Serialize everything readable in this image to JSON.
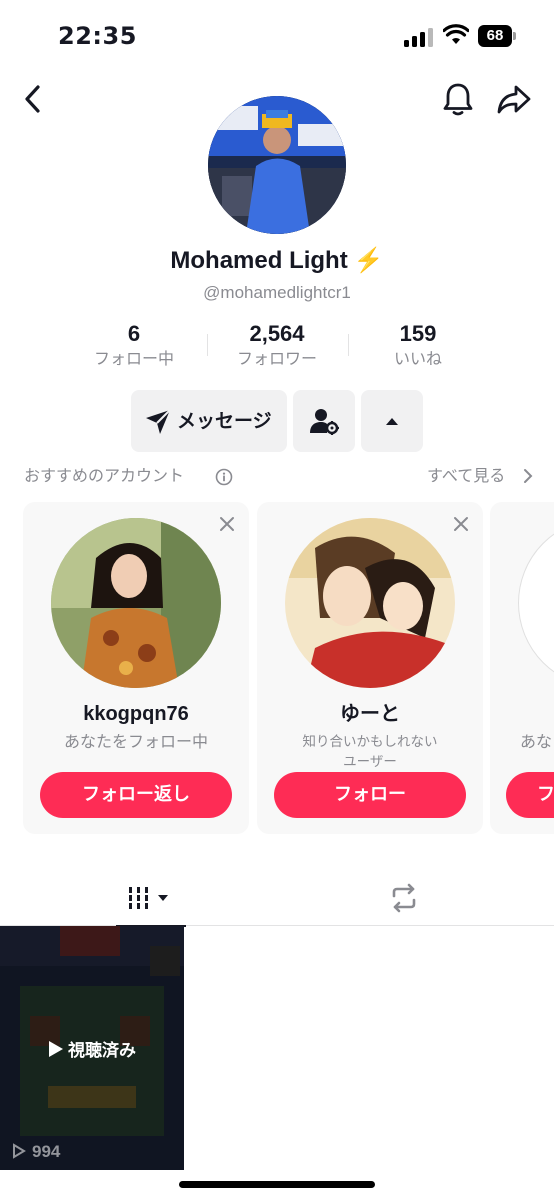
{
  "status_bar": {
    "time": "22:35",
    "battery": "68"
  },
  "profile": {
    "name": "Mohamed Light",
    "verified_emoji": "⚡",
    "handle": "@mohamedlightcr1"
  },
  "stats": [
    {
      "value": "6",
      "label": "フォロー中"
    },
    {
      "value": "2,564",
      "label": "フォロワー"
    },
    {
      "value": "159",
      "label": "いいね"
    }
  ],
  "actions": {
    "message_label": "メッセージ"
  },
  "suggested": {
    "title": "おすすめのアカウント",
    "see_all": "すべて見る",
    "cards": [
      {
        "name": "kkogpqn76",
        "subtitle": "あなたをフォロー中",
        "button": "フォロー返し"
      },
      {
        "name": "ゆーと",
        "subtitle_line1": "知り合いかもしれない",
        "subtitle_line2": "ユーザー",
        "button": "フォロー"
      },
      {
        "subtitle": "あな",
        "button": "フ"
      }
    ]
  },
  "video": {
    "watched_label": "視聴済み",
    "views": "994"
  },
  "icons": [
    "back-icon",
    "bell-icon",
    "share-icon",
    "send-icon",
    "friend-settings-icon",
    "caret-up-icon",
    "info-icon",
    "close-icon",
    "grid-icon",
    "repost-icon",
    "play-icon"
  ],
  "colors": {
    "accent": "#fe2c55",
    "secondary_text": "#8a8b91",
    "button_gray": "#f1f1f2",
    "bolt": "#f5b400"
  }
}
